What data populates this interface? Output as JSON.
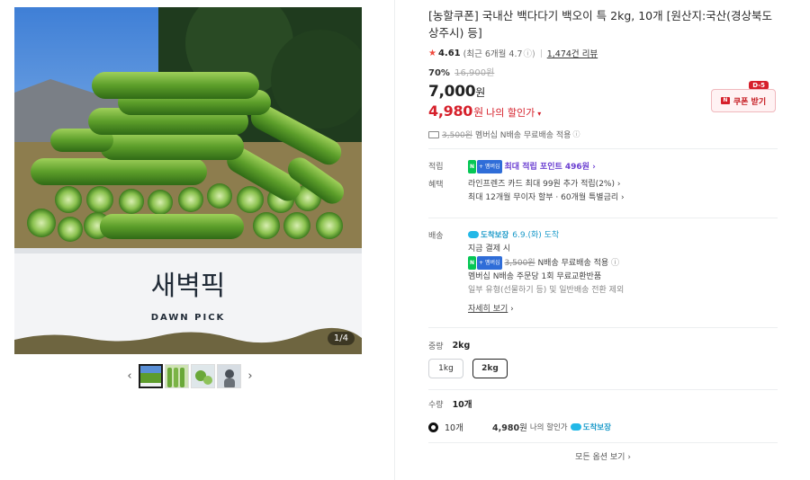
{
  "gallery": {
    "page_indicator": "1/4",
    "brand_korean": "새벽픽",
    "brand_english": "DAWN PICK",
    "prev_arrow": "‹",
    "next_arrow": "›"
  },
  "product": {
    "title": "[농할쿠폰] 국내산 백다다기 백오이 특 2kg, 10개 [원산지:국산(경상북도 상주시) 등]",
    "rating": "4.61",
    "rating_recent": "(최근 6개월 4.7",
    "rating_info": "ⓘ)",
    "review_count": "1,474건 리뷰",
    "discount_pct": "70%",
    "original_price": "16,900원",
    "price": "7,000",
    "price_unit": "원",
    "my_price": "4,980",
    "my_price_unit": "원",
    "my_price_label": "나의 할인가",
    "coupon_button": "쿠폰 받기",
    "coupon_badge": "D-5",
    "shipping_strike": "3,500원",
    "shipping_text": "멤버십 N배송 무료배송 적용",
    "info_icon": "ⓘ"
  },
  "details": {
    "points_key": "적립",
    "points_text": "최대 적립 포인트 496원",
    "benefit_key": "혜택",
    "benefit_line1": "라인프렌즈 카드 최대 99원 추가 적립(2%)",
    "benefit_line2": "최대 12개월 무이자 할부 · 60개월 특별금리",
    "delivery_key": "배송",
    "delivery_tag": "도착보장",
    "delivery_date": "6.9.(화) 도착",
    "delivery_line1": "지금 결제 시",
    "delivery_strike": "3,500원",
    "delivery_line2": "N배송 무료배송 적용",
    "delivery_line3": "멤버십 N배송 주문당 1회 무료교환반품",
    "delivery_line4": "일부 유형(선물하기 등) 및 일반배송 전환 제외",
    "more_link": "자세히 보기",
    "npay_badge": "N",
    "plus_badge": "+ 멤버십"
  },
  "options": {
    "weight_label": "중량",
    "weight_selected": "2kg",
    "weights": [
      "1kg",
      "2kg"
    ],
    "qty_label": "수량",
    "qty_selected": "10개",
    "row_qty": "10개",
    "row_price": "4,980",
    "row_unit": "원",
    "row_label": "나의 할인가",
    "row_tag": "도착보장",
    "all_options": "모든 옵션 보기"
  },
  "colors": {
    "accent_red": "#d6202b",
    "points_purple": "#6b3fd1",
    "arrival_blue": "#1b9ac9"
  }
}
